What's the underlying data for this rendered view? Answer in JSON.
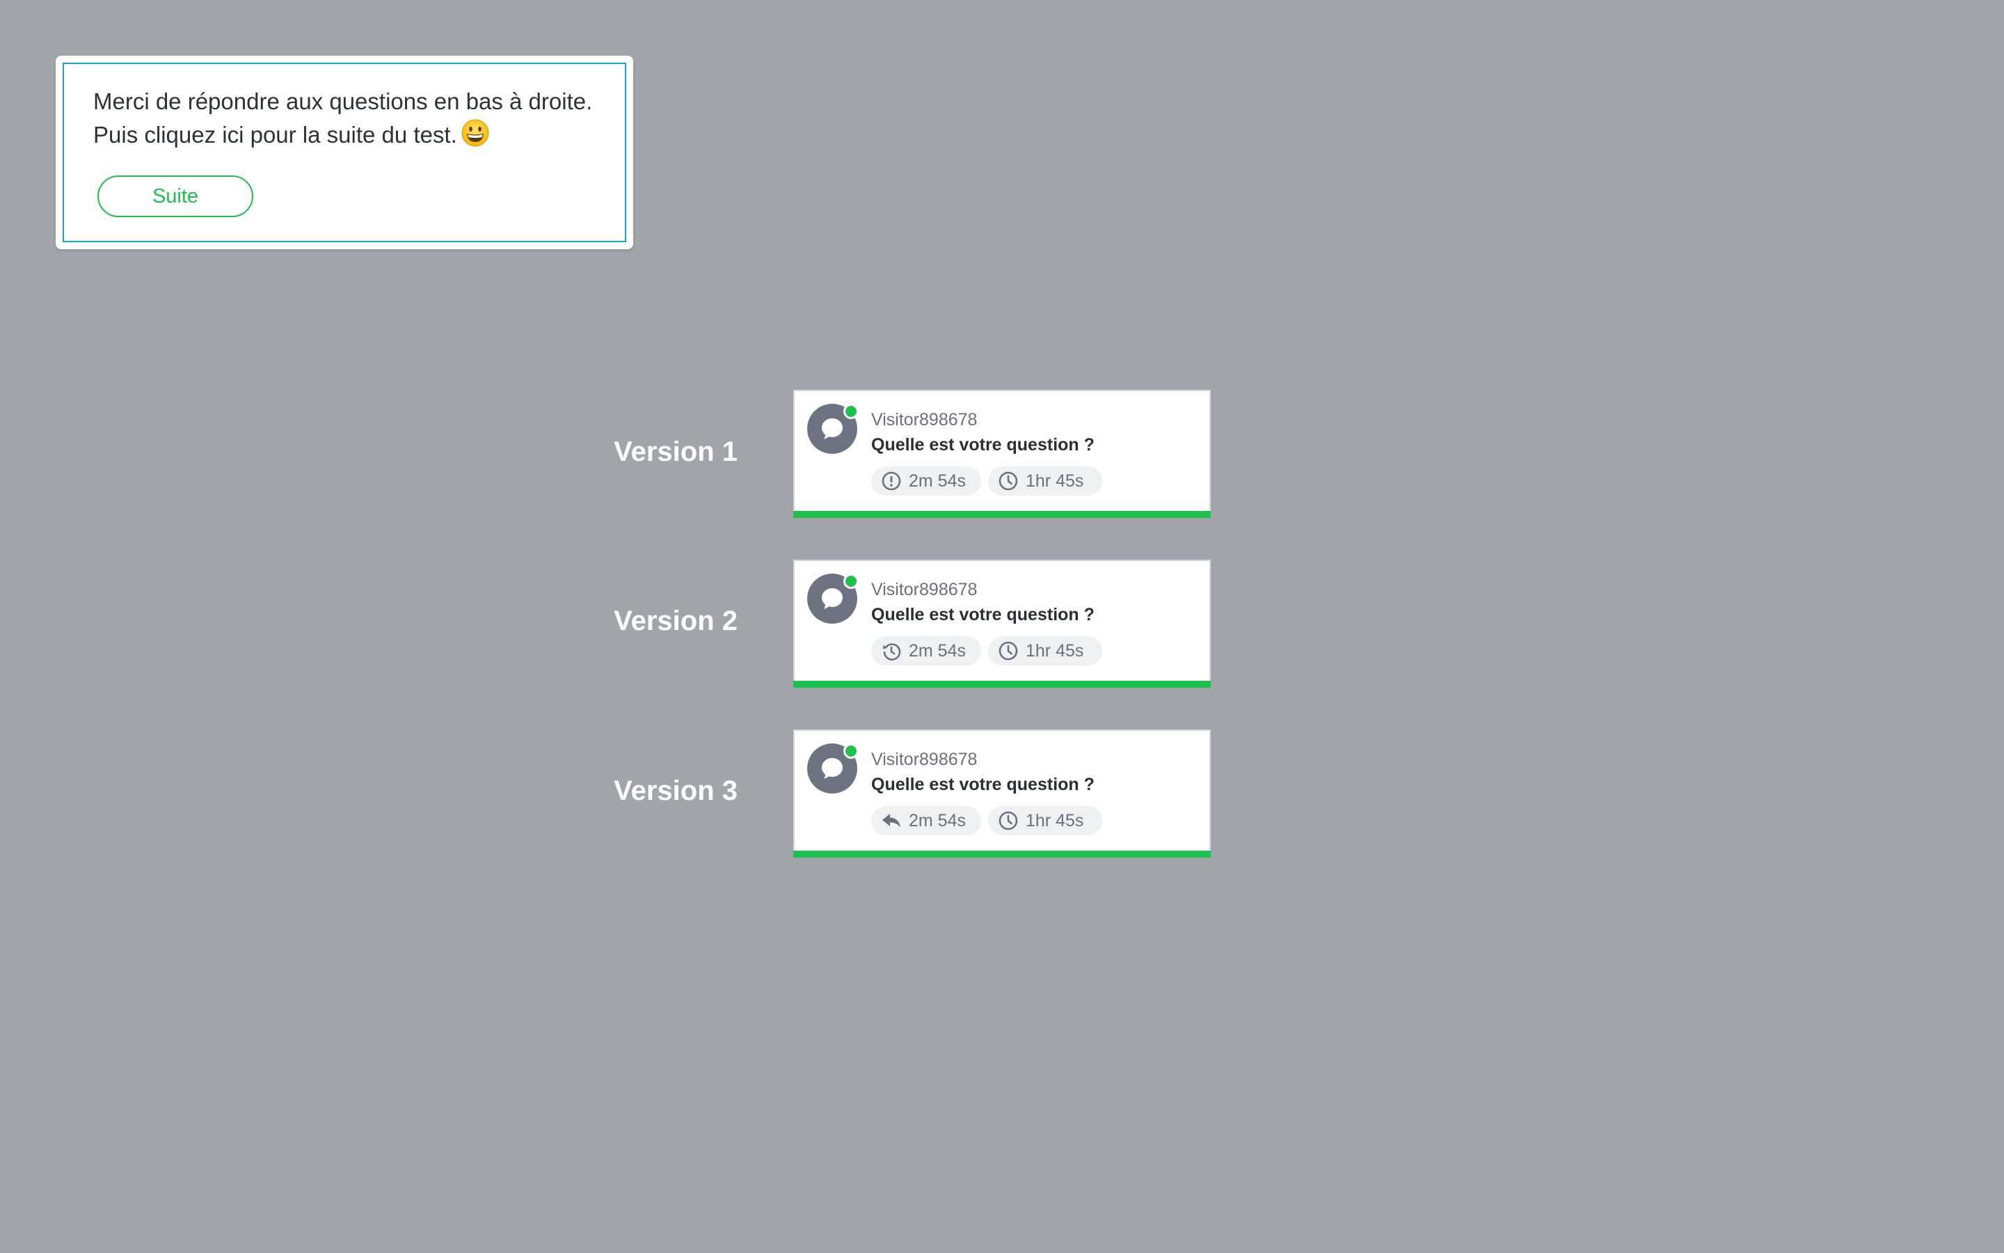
{
  "popup": {
    "message": "Merci de répondre aux questions en bas à droite. Puis cliquez ici pour la suite du test.",
    "emoji": "grinning-face-emoji",
    "next_label": "Suite"
  },
  "colors": {
    "background": "#a1a5a9",
    "accent_green": "#1ec04e",
    "popup_border": "#1aa0e0",
    "avatar": "#6e7381"
  },
  "versions": [
    {
      "label": "Version 1",
      "visitor": "Visitor898678",
      "question": "Quelle est votre question ?",
      "wait_icon": "alert-circle-icon",
      "wait_time": "2m 54s",
      "duration_icon": "clock-icon",
      "duration": "1hr 45s"
    },
    {
      "label": "Version 2",
      "visitor": "Visitor898678",
      "question": "Quelle est votre question ?",
      "wait_icon": "history-icon",
      "wait_time": "2m 54s",
      "duration_icon": "clock-icon",
      "duration": "1hr 45s"
    },
    {
      "label": "Version 3",
      "visitor": "Visitor898678",
      "question": "Quelle est votre question ?",
      "wait_icon": "reply-icon",
      "wait_time": "2m 54s",
      "duration_icon": "clock-icon",
      "duration": "1hr 45s"
    }
  ]
}
